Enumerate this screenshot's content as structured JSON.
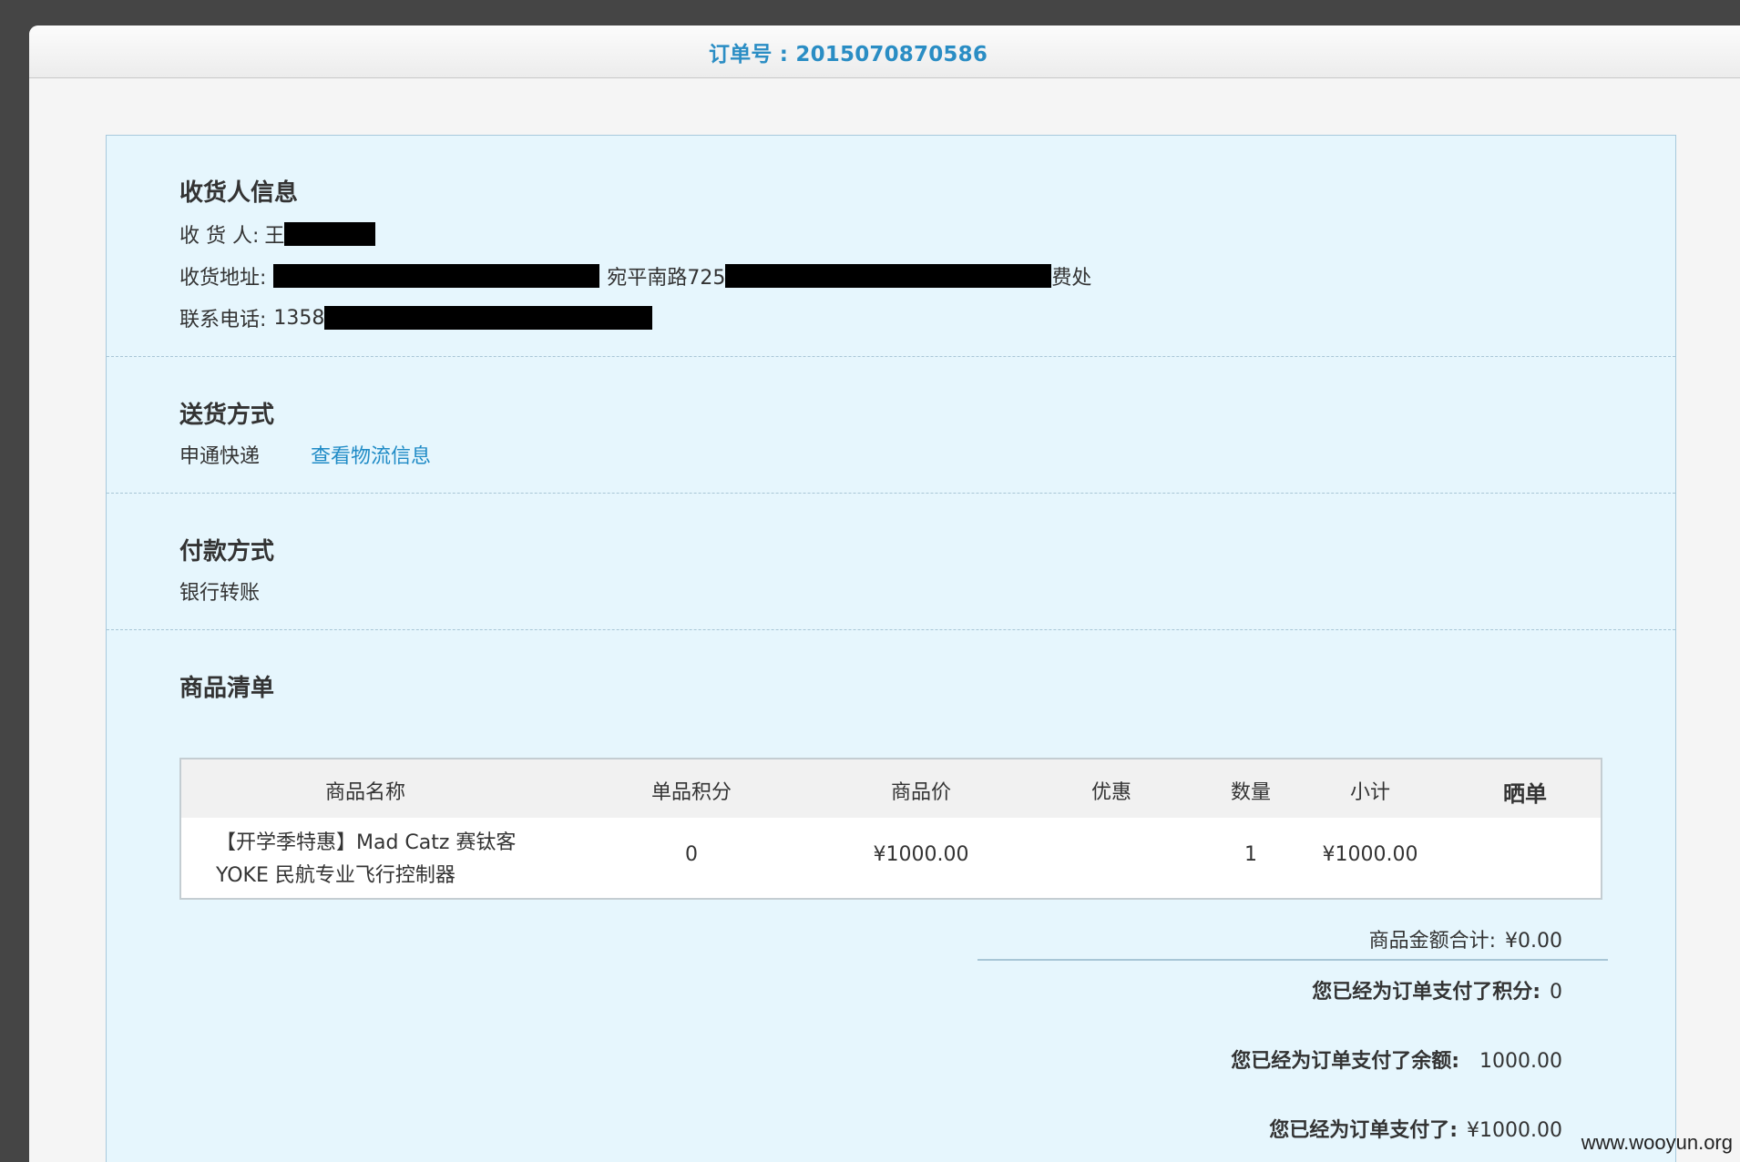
{
  "window": {
    "title": "订单号 : 2015070870586"
  },
  "consignee": {
    "title": "收货人信息",
    "name_label": "收 货 人:",
    "name_prefix": "王",
    "address_label": "收货地址:",
    "address_mid": "宛平南路725",
    "address_tail": "费处",
    "phone_label": "联系电话:",
    "phone_prefix": "1358"
  },
  "shipping": {
    "title": "送货方式",
    "method": "申通快递",
    "logistics_link": "查看物流信息"
  },
  "payment": {
    "title": "付款方式",
    "method": "银行转账"
  },
  "products": {
    "title": "商品清单",
    "columns": [
      "商品名称",
      "单品积分",
      "商品价",
      "优惠",
      "数量",
      "小计",
      "晒单"
    ],
    "rows": [
      {
        "name": "【开学季特惠】Mad Catz 赛钛客 YOKE 民航专业飞行控制器",
        "points": "0",
        "price": "¥1000.00",
        "discount": "",
        "quantity": "1",
        "subtotal": "¥1000.00",
        "review": ""
      }
    ]
  },
  "summary": {
    "total_label": "商品金额合计:",
    "total_value": "¥0.00",
    "points_label": "您已经为订单支付了积分:",
    "points_value": "0",
    "balance_label": "您已经为订单支付了余额:",
    "balance_value": "1000.00",
    "paid_label": "您已经为订单支付了:",
    "paid_value": "¥1000.00"
  },
  "watermark": "www.wooyun.org"
}
